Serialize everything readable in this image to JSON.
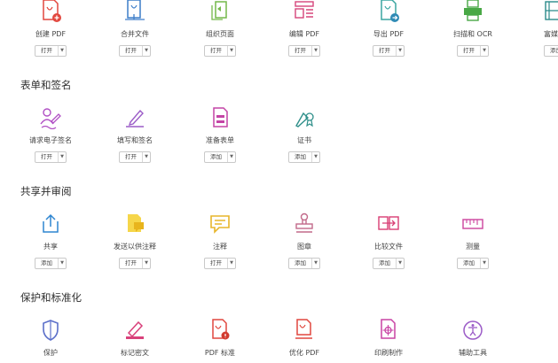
{
  "row1": [
    {
      "label": "创建 PDF",
      "btn": "打开",
      "icon": "create-pdf-icon"
    },
    {
      "label": "合并文件",
      "btn": "打开",
      "icon": "combine-files-icon"
    },
    {
      "label": "组织页面",
      "btn": "打开",
      "icon": "organize-pages-icon"
    },
    {
      "label": "编辑 PDF",
      "btn": "打开",
      "icon": "edit-pdf-icon"
    },
    {
      "label": "导出 PDF",
      "btn": "打开",
      "icon": "export-pdf-icon"
    },
    {
      "label": "扫描和 OCR",
      "btn": "打开",
      "icon": "scan-ocr-icon"
    },
    {
      "label": "富媒",
      "btn": "添加",
      "icon": "rich-media-icon"
    }
  ],
  "sections": {
    "forms": "表单和签名",
    "share": "共享并审阅",
    "protect": "保护和标准化"
  },
  "forms": [
    {
      "label": "请求电子签名",
      "btn": "打开"
    },
    {
      "label": "填写和签名",
      "btn": "打开"
    },
    {
      "label": "准备表单",
      "btn": "添加"
    },
    {
      "label": "证书",
      "btn": "添加"
    }
  ],
  "share": [
    {
      "label": "共享",
      "btn": "添加"
    },
    {
      "label": "发送以供注释",
      "btn": "打开"
    },
    {
      "label": "注释",
      "btn": "打开"
    },
    {
      "label": "图章",
      "btn": "添加"
    },
    {
      "label": "比较文件",
      "btn": "添加"
    },
    {
      "label": "测量",
      "btn": "添加"
    }
  ],
  "protect": [
    {
      "label": "保护"
    },
    {
      "label": "标记密文"
    },
    {
      "label": "PDF 标准"
    },
    {
      "label": "优化 PDF"
    },
    {
      "label": "印刷制作"
    },
    {
      "label": "辅助工具"
    }
  ]
}
